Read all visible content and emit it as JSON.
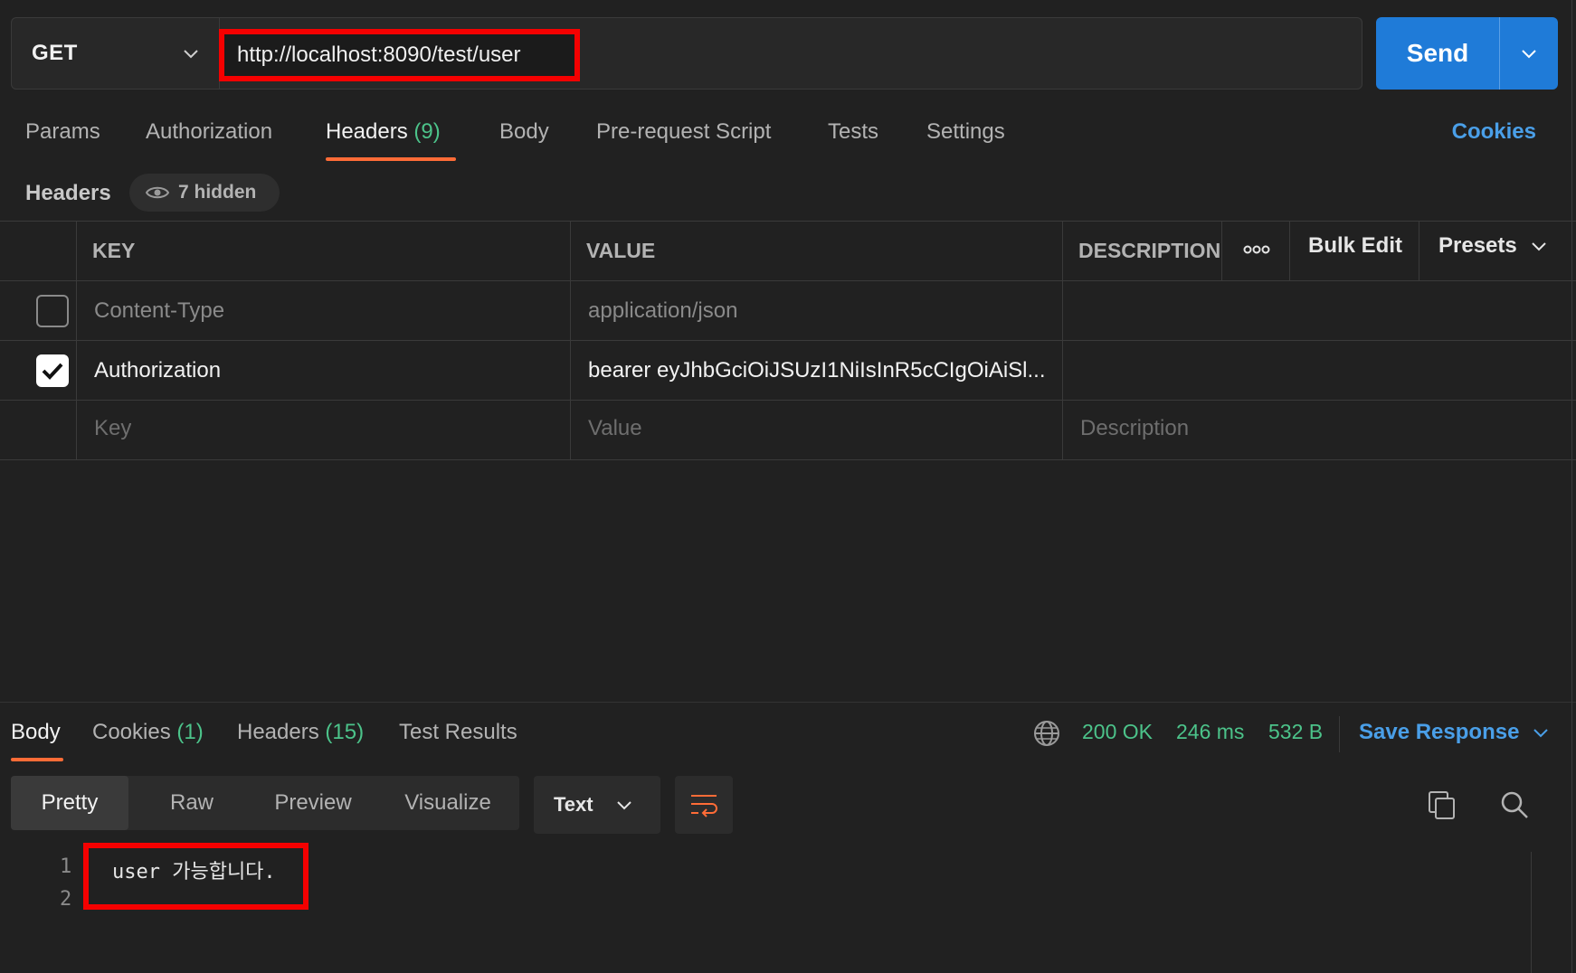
{
  "request": {
    "method": "GET",
    "url": "http://localhost:8090/test/user",
    "send_label": "Send"
  },
  "request_tabs": {
    "params": "Params",
    "authorization": "Authorization",
    "headers": "Headers",
    "headers_count": "(9)",
    "body": "Body",
    "pre_request_script": "Pre-request Script",
    "tests": "Tests",
    "settings": "Settings",
    "cookies": "Cookies"
  },
  "headers_section": {
    "title": "Headers",
    "hidden_label": "7 hidden"
  },
  "headers_table": {
    "columns": {
      "key": "KEY",
      "value": "VALUE",
      "description": "DESCRIPTION"
    },
    "bulk_edit": "Bulk Edit",
    "presets": "Presets",
    "rows": [
      {
        "checked": false,
        "key": "Content-Type",
        "value": "application/json",
        "description": ""
      },
      {
        "checked": true,
        "key": "Authorization",
        "value": "bearer eyJhbGciOiJSUzI1NiIsInR5cCIgOiAiSl...",
        "description": ""
      }
    ],
    "placeholders": {
      "key": "Key",
      "value": "Value",
      "description": "Description"
    }
  },
  "response": {
    "tabs": {
      "body": "Body",
      "cookies": "Cookies",
      "cookies_count": "(1)",
      "headers": "Headers",
      "headers_count": "(15)",
      "test_results": "Test Results"
    },
    "status": "200 OK",
    "time": "246 ms",
    "size": "532 B",
    "save_response": "Save Response",
    "views": [
      "Pretty",
      "Raw",
      "Preview",
      "Visualize"
    ],
    "format": "Text",
    "lines": [
      "1",
      "2"
    ],
    "code": "user 가능합니다."
  },
  "colors": {
    "accent_orange": "#ff6c37",
    "send_blue": "#1f7bd8",
    "link_blue": "#4a9fe8",
    "status_green": "#4cc38a",
    "annotation_red": "#f50000"
  }
}
